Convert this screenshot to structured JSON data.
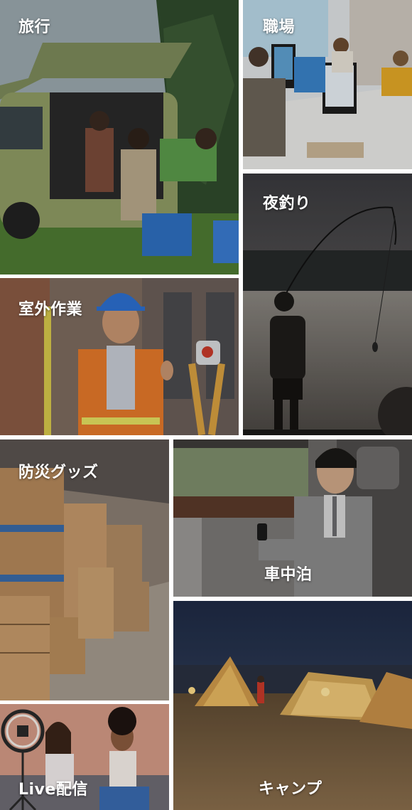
{
  "tiles": [
    {
      "id": "travel",
      "label": "旅行"
    },
    {
      "id": "office",
      "label": "職場"
    },
    {
      "id": "fishing",
      "label": "夜釣り"
    },
    {
      "id": "outdoor",
      "label": "室外作業"
    },
    {
      "id": "disaster",
      "label": "防災グッズ"
    },
    {
      "id": "car",
      "label": "車中泊"
    },
    {
      "id": "camp",
      "label": "キャンプ"
    },
    {
      "id": "live",
      "label": "Live配信"
    }
  ]
}
